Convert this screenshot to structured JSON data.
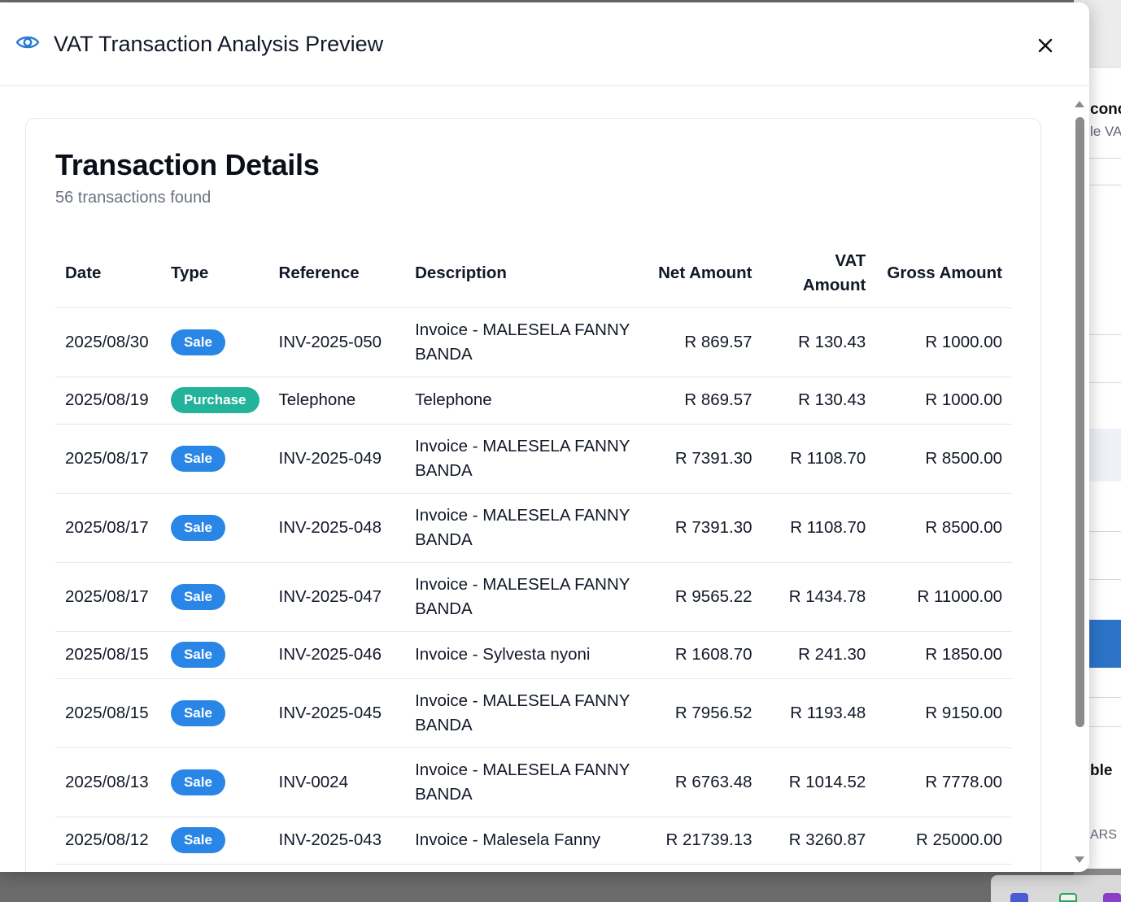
{
  "background_app": {
    "snippet_1": "conc",
    "snippet_2": "le VA",
    "snippet_3": "ble",
    "snippet_4": "ARS"
  },
  "modal": {
    "title": "VAT Transaction Analysis Preview",
    "header_icon": "eye-icon",
    "close_icon": "close-icon"
  },
  "card": {
    "title": "Transaction Details",
    "subtitle": "56 transactions found"
  },
  "table": {
    "headers": {
      "date": "Date",
      "type": "Type",
      "reference": "Reference",
      "description": "Description",
      "net_amount": "Net Amount",
      "vat_amount": "VAT Amount",
      "gross_amount": "Gross Amount"
    },
    "rows": [
      {
        "date": "2025/08/30",
        "type": "Sale",
        "reference": "INV-2025-050",
        "description": "Invoice - MALESELA FANNY BANDA",
        "net": "R 869.57",
        "vat": "R 130.43",
        "gross": "R 1000.00"
      },
      {
        "date": "2025/08/19",
        "type": "Purchase",
        "reference": "Telephone",
        "description": "Telephone",
        "net": "R 869.57",
        "vat": "R 130.43",
        "gross": "R 1000.00"
      },
      {
        "date": "2025/08/17",
        "type": "Sale",
        "reference": "INV-2025-049",
        "description": "Invoice - MALESELA FANNY BANDA",
        "net": "R 7391.30",
        "vat": "R 1108.70",
        "gross": "R 8500.00"
      },
      {
        "date": "2025/08/17",
        "type": "Sale",
        "reference": "INV-2025-048",
        "description": "Invoice - MALESELA FANNY BANDA",
        "net": "R 7391.30",
        "vat": "R 1108.70",
        "gross": "R 8500.00"
      },
      {
        "date": "2025/08/17",
        "type": "Sale",
        "reference": "INV-2025-047",
        "description": "Invoice - MALESELA FANNY BANDA",
        "net": "R 9565.22",
        "vat": "R 1434.78",
        "gross": "R 11000.00"
      },
      {
        "date": "2025/08/15",
        "type": "Sale",
        "reference": "INV-2025-046",
        "description": "Invoice - Sylvesta nyoni",
        "net": "R 1608.70",
        "vat": "R 241.30",
        "gross": "R 1850.00"
      },
      {
        "date": "2025/08/15",
        "type": "Sale",
        "reference": "INV-2025-045",
        "description": "Invoice - MALESELA FANNY BANDA",
        "net": "R 7956.52",
        "vat": "R 1193.48",
        "gross": "R 9150.00"
      },
      {
        "date": "2025/08/13",
        "type": "Sale",
        "reference": "INV-0024",
        "description": "Invoice - MALESELA FANNY BANDA",
        "net": "R 6763.48",
        "vat": "R 1014.52",
        "gross": "R 7778.00"
      },
      {
        "date": "2025/08/12",
        "type": "Sale",
        "reference": "INV-2025-043",
        "description": "Invoice - Malesela Fanny",
        "net": "R 21739.13",
        "vat": "R 3260.87",
        "gross": "R 25000.00"
      }
    ]
  },
  "colors": {
    "sale_badge": "#2a86e6",
    "purchase_badge": "#23b39b",
    "icon_blue": "#2a7bd6"
  }
}
